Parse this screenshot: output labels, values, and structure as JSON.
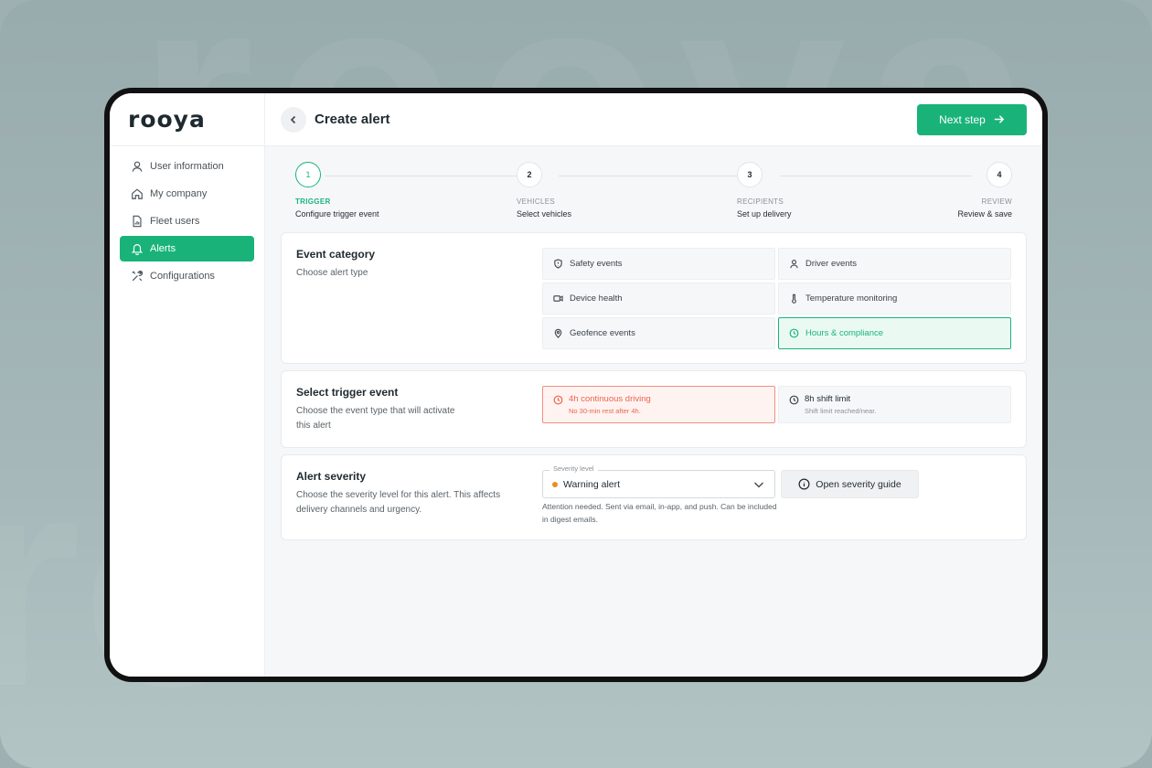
{
  "app": {
    "logo": "rooya"
  },
  "sidebar": {
    "items": [
      {
        "label": "User information",
        "icon": "user-icon",
        "active": false
      },
      {
        "label": "My company",
        "icon": "home-icon",
        "active": false
      },
      {
        "label": "Fleet users",
        "icon": "report-icon",
        "active": false
      },
      {
        "label": "Alerts",
        "icon": "bell-icon",
        "active": true
      },
      {
        "label": "Configurations",
        "icon": "tools-icon",
        "active": false
      }
    ]
  },
  "header": {
    "title": "Create alert",
    "next_label": "Next step"
  },
  "stepper": {
    "steps": [
      {
        "number": "1",
        "label": "TRIGGER",
        "sub": "Configure trigger event"
      },
      {
        "number": "2",
        "label": "VEHICLES",
        "sub": "Select vehicles"
      },
      {
        "number": "3",
        "label": "RECIPIENTS",
        "sub": "Set up delivery"
      },
      {
        "number": "4",
        "label": "REVIEW",
        "sub": "Review & save"
      }
    ],
    "active_step": 1
  },
  "event_category": {
    "title": "Event category",
    "desc": "Choose alert type",
    "options": [
      {
        "label": "Safety events",
        "icon": "shield-icon"
      },
      {
        "label": "Driver events",
        "icon": "user-icon"
      },
      {
        "label": "Device health",
        "icon": "camera-icon"
      },
      {
        "label": "Temperature monitoring",
        "icon": "thermometer-icon"
      },
      {
        "label": "Geofence events",
        "icon": "location-pin-icon"
      },
      {
        "label": "Hours & compliance",
        "icon": "clock-icon"
      }
    ],
    "selected": "Hours & compliance"
  },
  "trigger_event": {
    "title": "Select trigger event",
    "desc": "Choose the event type that will activate this alert",
    "options": [
      {
        "title": "4h continuous driving",
        "sub": "No 30-min rest after 4h.",
        "icon": "clock-alert-icon"
      },
      {
        "title": "8h shift limit",
        "sub": "Shift limit reached/near.",
        "icon": "clock-icon"
      }
    ],
    "selected": "4h continuous driving"
  },
  "severity": {
    "title": "Alert severity",
    "desc": "Choose the severity level for this alert. This affects delivery channels and urgency.",
    "field_label": "Severity level",
    "value": "Warning alert",
    "dot_color": "#f08a24",
    "help": "Attention needed. Sent via email, in-app, and push. Can be included in digest emails.",
    "guide_label": "Open severity guide"
  },
  "colors": {
    "accent": "#19b37a",
    "alert": "#e8664e"
  }
}
